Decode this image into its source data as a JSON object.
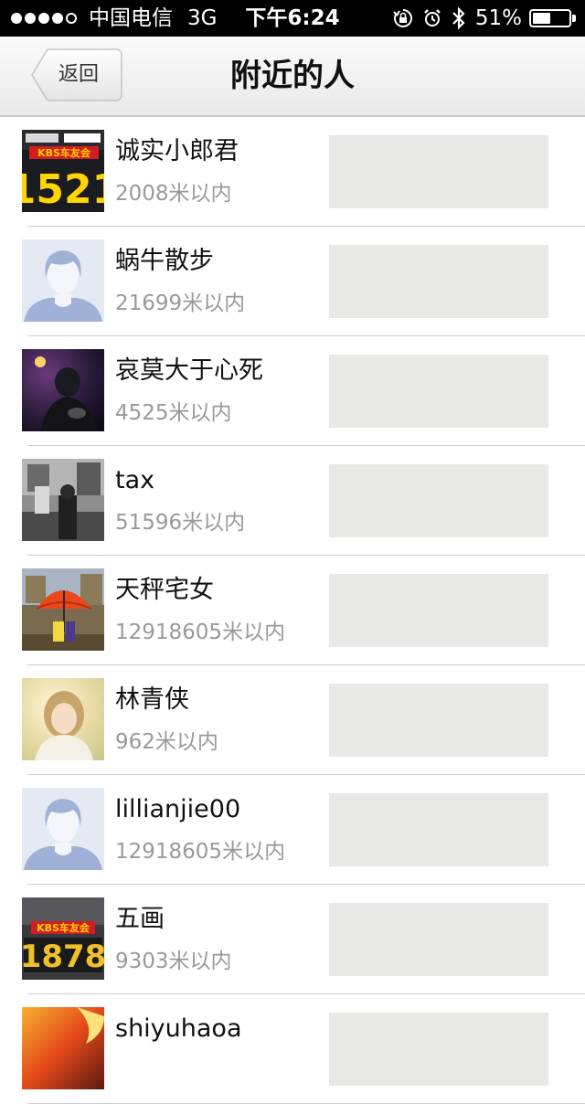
{
  "status_bar": {
    "carrier": "中国电信",
    "network": "3G",
    "time": "下午6:24",
    "battery_percent": "51%",
    "battery_level": 0.51,
    "signal_bars": 4,
    "icons": [
      "rotation-lock-icon",
      "alarm-icon",
      "bluetooth-icon",
      "battery-icon"
    ]
  },
  "nav": {
    "back_label": "返回",
    "title": "附近的人"
  },
  "people": [
    {
      "name": "诚实小郎君",
      "distance": "2008米以内",
      "avatar": "kbs-1521-avatar"
    },
    {
      "name": "蜗牛散步",
      "distance": "21699米以内",
      "avatar": "default-person-avatar"
    },
    {
      "name": "哀莫大于心死",
      "distance": "4525米以内",
      "avatar": "dark-photo-avatar"
    },
    {
      "name": "tax",
      "distance": "51596米以内",
      "avatar": "street-bw-avatar"
    },
    {
      "name": "天秤宅女",
      "distance": "12918605米以内",
      "avatar": "umbrella-cartoon-avatar"
    },
    {
      "name": "林青侠",
      "distance": "962米以内",
      "avatar": "girl-photo-avatar"
    },
    {
      "name": "lillianjie00",
      "distance": "12918605米以内",
      "avatar": "default-person-avatar"
    },
    {
      "name": "五画",
      "distance": "9303米以内",
      "avatar": "kbs-1878-avatar"
    },
    {
      "name": "shiyuhaoa",
      "distance": "",
      "avatar": "fire-avatar"
    }
  ],
  "avatar_text": {
    "kbs1521": {
      "top": "KBS车友会",
      "number": "1521"
    },
    "kbs1878": {
      "top": "KBS车友会",
      "number": "1878"
    }
  },
  "colors": {
    "status_bar_bg": "#000000",
    "divider": "#cfcfcf",
    "distance_text": "#999999",
    "thumb_placeholder": "#e8e8e6"
  }
}
